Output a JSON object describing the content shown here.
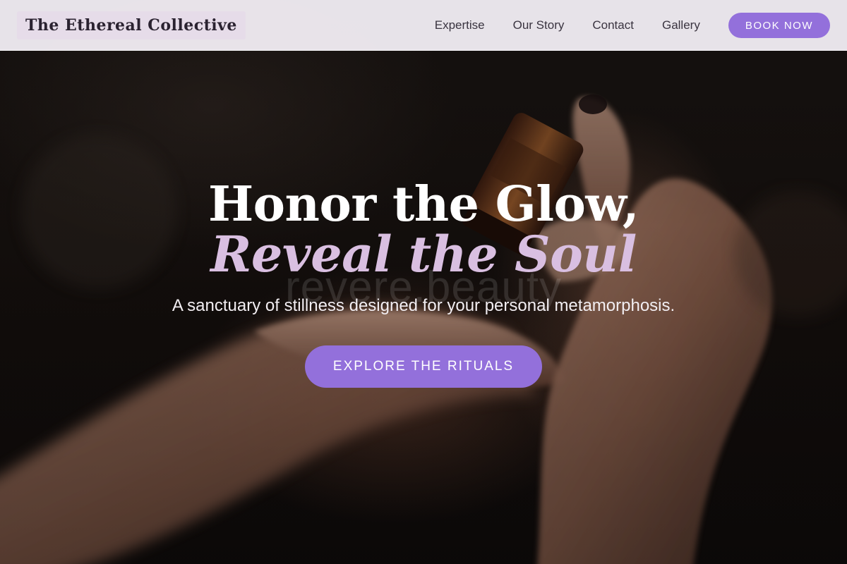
{
  "header": {
    "logo": "The Ethereal Collective",
    "nav": [
      {
        "label": "Expertise"
      },
      {
        "label": "Our Story"
      },
      {
        "label": "Contact"
      },
      {
        "label": "Gallery"
      }
    ],
    "book_button": "BOOK NOW"
  },
  "hero": {
    "headline_line1": "Honor the Glow,",
    "headline_line2": "Reveal the Soul",
    "bottle_label": "revere.beauty",
    "tagline": "A sanctuary of stillness designed for your personal metamorphosis.",
    "cta_button": "EXPLORE THE RITUALS",
    "background_image": "hands-holding-essential-oil-bottle"
  },
  "colors": {
    "accent": "#9370db",
    "accent_light": "#d9bfe1",
    "header_bg": "#f0ecf2",
    "logo_bg": "#e6dce9",
    "text_dark": "#2a2230"
  }
}
